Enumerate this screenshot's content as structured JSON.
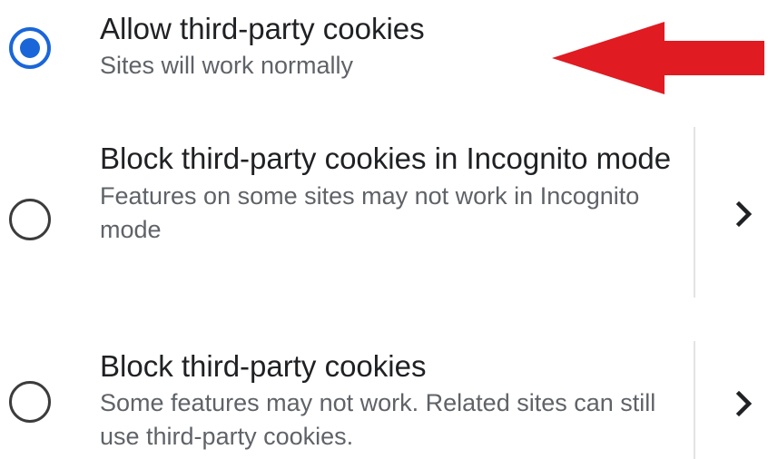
{
  "options": [
    {
      "title": "Allow third-party cookies",
      "summary": "Sites will work normally",
      "selected": true
    },
    {
      "title": "Block third-party cookies in Incognito mode",
      "summary": "Features on some sites may not work in Incognito mode",
      "selected": false
    },
    {
      "title": "Block third-party cookies",
      "summary": "Some features may not work. Related sites can still use third-party cookies.",
      "selected": false
    }
  ],
  "colors": {
    "accent": "#1a66d9",
    "annotation_arrow": "#e01b22",
    "title_text": "#202124",
    "summary_text": "#5f6368"
  },
  "icons": {
    "more": "chevron-right-icon",
    "annotation": "red-arrow-left-icon"
  }
}
